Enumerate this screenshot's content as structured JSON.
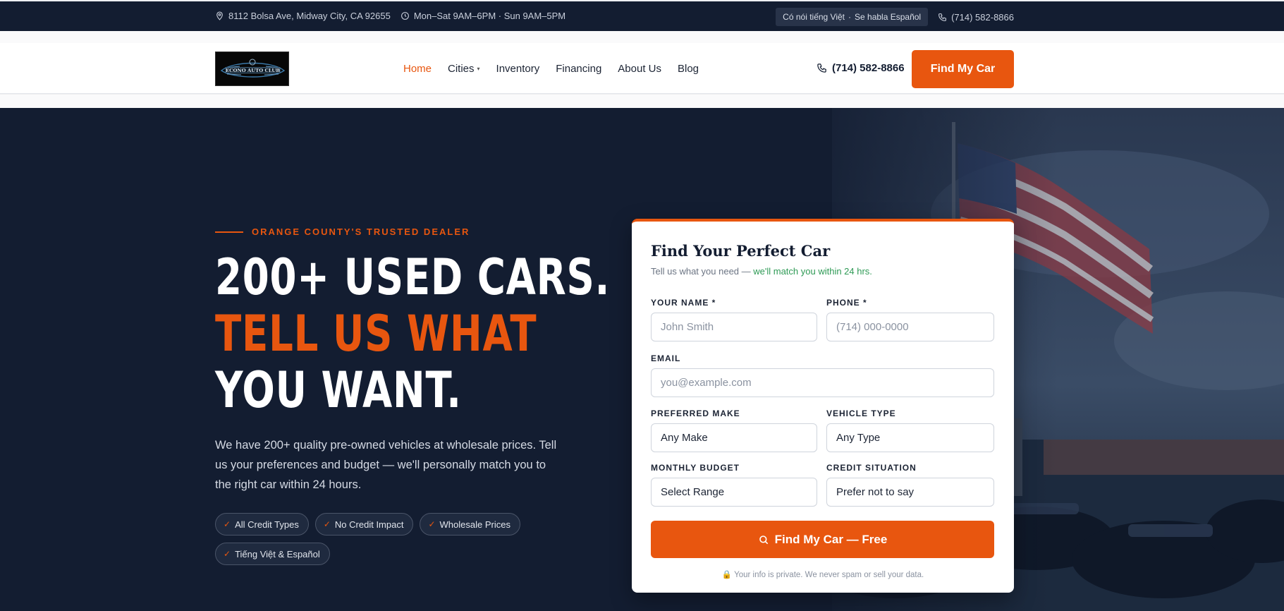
{
  "topbar": {
    "address": "8112 Bolsa Ave, Midway City, CA 92655",
    "hours": "Mon–Sat 9AM–6PM · Sun 9AM–5PM",
    "lang_vi": "Có nói tiếng Việt",
    "lang_sep": "·",
    "lang_es": "Se habla Español",
    "phone": "(714) 582-8866"
  },
  "header": {
    "logo_text": "ECONO AUTO CLUB",
    "nav": [
      {
        "label": "Home"
      },
      {
        "label": "Cities"
      },
      {
        "label": "Inventory"
      },
      {
        "label": "Financing"
      },
      {
        "label": "About Us"
      },
      {
        "label": "Blog"
      }
    ],
    "phone": "(714) 582-8866",
    "cta": "Find My Car"
  },
  "hero": {
    "eyebrow": "ORANGE COUNTY'S TRUSTED DEALER",
    "headline_1": "200+ USED CARS.",
    "headline_2": "TELL US WHAT",
    "headline_3": "YOU WANT.",
    "lead": "We have 200+ quality pre-owned vehicles at wholesale prices. Tell us your preferences and budget — we'll personally match you to the right car within 24 hours.",
    "pills": [
      {
        "label": "All Credit Types"
      },
      {
        "label": "No Credit Impact"
      },
      {
        "label": "Wholesale Prices"
      },
      {
        "label": "Tiếng Việt & Español"
      }
    ]
  },
  "form": {
    "title": "Find Your Perfect Car",
    "subtitle_prefix": "Tell us what you need — ",
    "subtitle_highlight": "we'll match you within 24 hrs.",
    "name_label": "YOUR NAME *",
    "name_placeholder": "John Smith",
    "phone_label": "PHONE *",
    "phone_placeholder": "(714) 000-0000",
    "email_label": "EMAIL",
    "email_placeholder": "you@example.com",
    "make_label": "PREFERRED MAKE",
    "make_value": "Any Make",
    "type_label": "VEHICLE TYPE",
    "type_value": "Any Type",
    "budget_label": "MONTHLY BUDGET",
    "budget_value": "Select Range",
    "credit_label": "CREDIT SITUATION",
    "credit_value": "Prefer not to say",
    "submit": "Find My Car — Free",
    "privacy": "Your info is private. We never spam or sell your data."
  },
  "colors": {
    "accent": "#e8560f",
    "navy": "#131d31",
    "success": "#2e9a55"
  }
}
